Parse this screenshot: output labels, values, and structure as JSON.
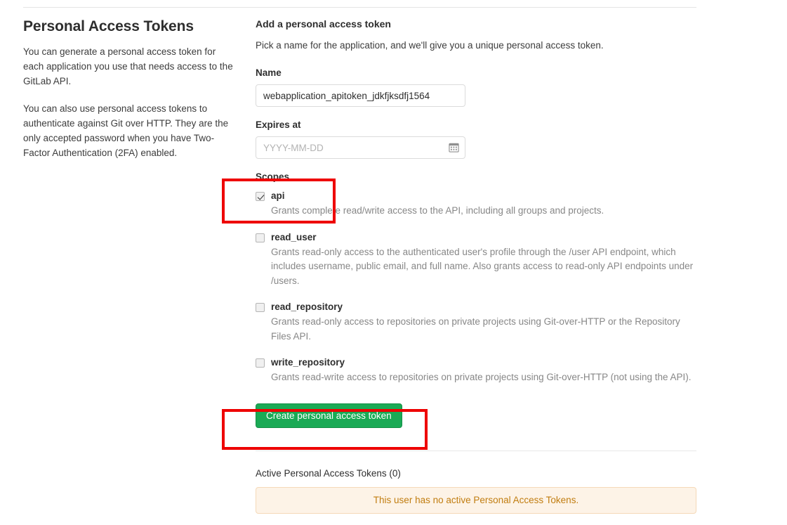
{
  "left": {
    "title": "Personal Access Tokens",
    "paragraphs": [
      "You can generate a personal access token for each application you use that needs access to the GitLab API.",
      "You can also use personal access tokens to authenticate against Git over HTTP. They are the only accepted password when you have Two-Factor Authentication (2FA) enabled."
    ]
  },
  "form": {
    "title": "Add a personal access token",
    "subtitle": "Pick a name for the application, and we'll give you a unique personal access token.",
    "name_label": "Name",
    "name_value": "webapplication_apitoken_jdkfjksdfj1564",
    "name_placeholder": "",
    "expires_label": "Expires at",
    "expires_value": "",
    "expires_placeholder": "YYYY-MM-DD",
    "calendar_icon": "calendar-icon",
    "scopes_label": "Scopes",
    "scopes": [
      {
        "name": "api",
        "checked": true,
        "description": "Grants complete read/write access to the API, including all groups and projects."
      },
      {
        "name": "read_user",
        "checked": false,
        "description": "Grants read-only access to the authenticated user's profile through the /user API endpoint, which includes username, public email, and full name. Also grants access to read-only API endpoints under /users."
      },
      {
        "name": "read_repository",
        "checked": false,
        "description": "Grants read-only access to repositories on private projects using Git-over-HTTP or the Repository Files API."
      },
      {
        "name": "write_repository",
        "checked": false,
        "description": "Grants read-write access to repositories on private projects using Git-over-HTTP (not using the API)."
      }
    ],
    "submit_label": "Create personal access token"
  },
  "active_tokens": {
    "heading": "Active Personal Access Tokens (0)",
    "empty_message": "This user has no active Personal Access Tokens."
  },
  "colors": {
    "button_green": "#1aaa55",
    "annotation_red": "#ee0000",
    "alert_background": "#fdf3e7",
    "alert_text": "#c17d10"
  }
}
